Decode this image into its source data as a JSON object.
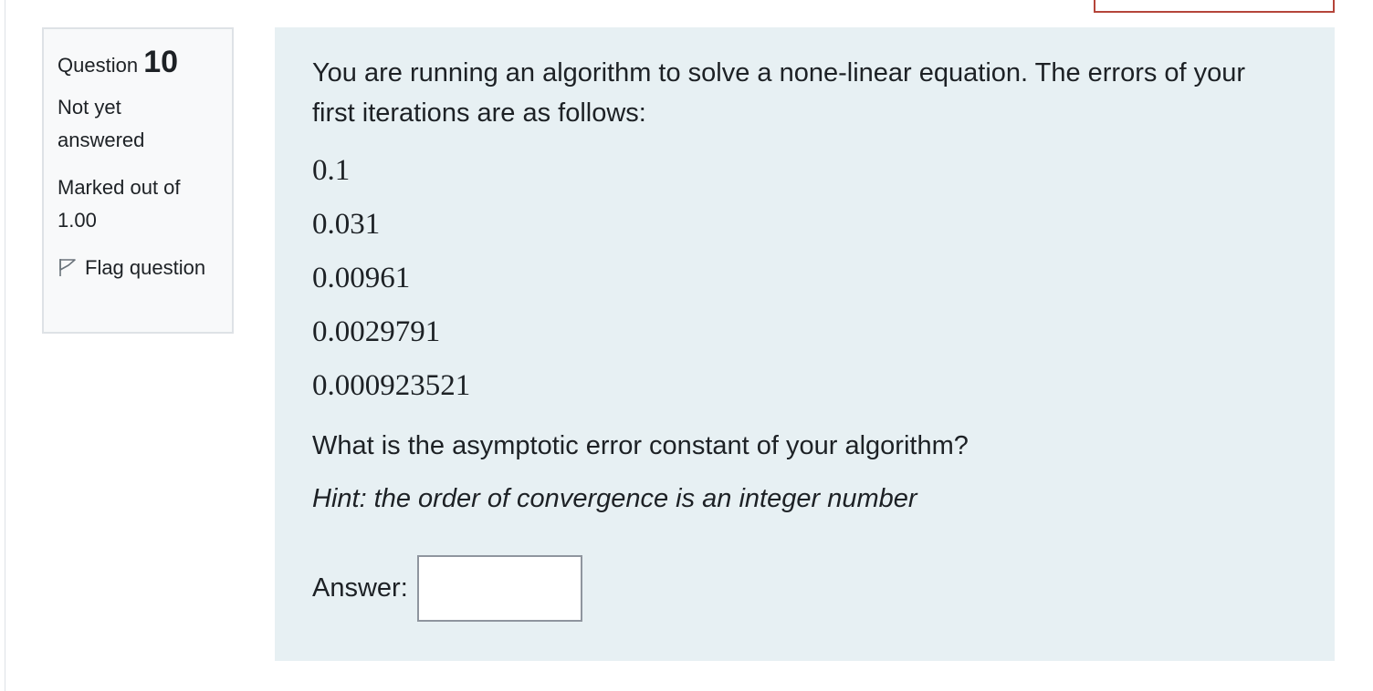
{
  "info": {
    "question_label": "Question",
    "question_number": "10",
    "state": "Not yet answered",
    "grade": "Marked out of 1.00",
    "flag_label": "Flag question"
  },
  "question": {
    "intro": "You are running an algorithm to solve a none-linear equation. The errors of your first iterations are as follows:",
    "errors": [
      "0.1",
      "0.031",
      "0.00961",
      "0.0029791",
      "0.000923521"
    ],
    "prompt": "What is the asymptotic error constant of your algorithm?",
    "hint": "Hint: the order of convergence is an integer number",
    "answer_label": "Answer:",
    "answer_value": ""
  },
  "colors": {
    "content_bg": "#e7f0f3",
    "info_bg": "#f8f9fa",
    "accent_border": "#b5453a"
  },
  "icons": {
    "flag": "flag-outline-icon"
  }
}
